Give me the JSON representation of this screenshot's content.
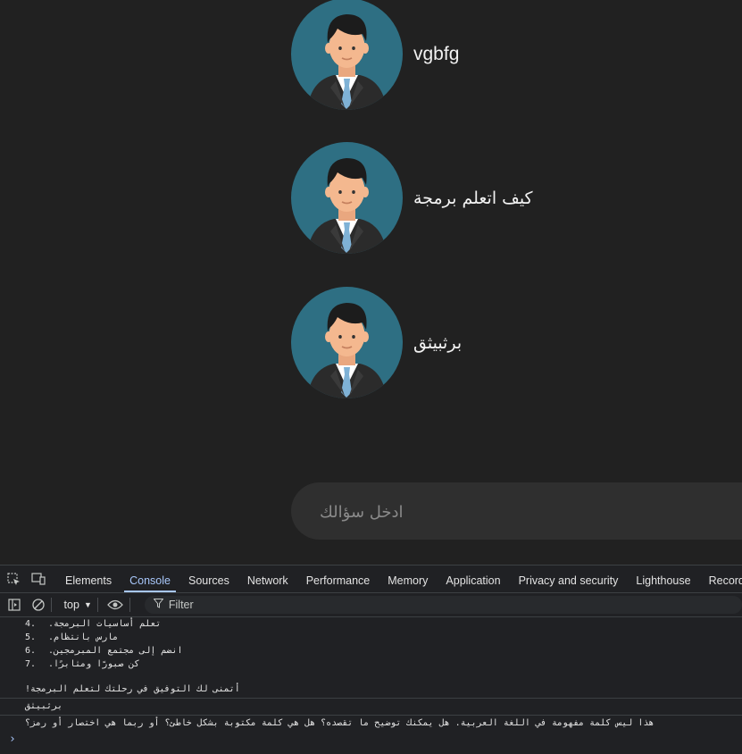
{
  "chat": {
    "messages": [
      {
        "text": "vgbfg",
        "avatar_icon": "businessman-avatar-icon"
      },
      {
        "text": "كيف اتعلم برمجة",
        "avatar_icon": "businessman-avatar-icon"
      },
      {
        "text": "برثبيثق",
        "avatar_icon": "businessman-avatar-icon"
      }
    ],
    "input": {
      "placeholder": "ادخل سؤالك"
    },
    "colors": {
      "background": "#212121",
      "input_bg": "#2f2f2f",
      "avatar_bg": "#2e6f83"
    }
  },
  "devtools": {
    "tabs": [
      "Elements",
      "Console",
      "Sources",
      "Network",
      "Performance",
      "Memory",
      "Application",
      "Privacy and security",
      "Lighthouse",
      "Recorder"
    ],
    "active_tab": "Console",
    "toolbar": {
      "context": "top",
      "filter_placeholder": "Filter"
    },
    "console": {
      "list_items": [
        {
          "num": "4.",
          "text": "تعلم أساسيات البرمجة."
        },
        {
          "num": "5.",
          "text": "مارس بانتظام."
        },
        {
          "num": "6.",
          "text": "انضم إلى مجتمع المبرمجين."
        },
        {
          "num": "7.",
          "text": "كن صبورًا ومثابرًا."
        }
      ],
      "closing_line": "أتمنى لك التوفيق في رحلتك لتعلم البرمجة!",
      "user_input_log": "برثبيثق",
      "response_log": "هذا ليس كلمة مفهومة في اللغة العربية. هل يمكنك توضيح ما تقصده؟ هل هي كلمة مكتوبة بشكل خاطئ؟ أو ربما هي اختصار أو رمز؟",
      "prompt_symbol": "›"
    }
  }
}
